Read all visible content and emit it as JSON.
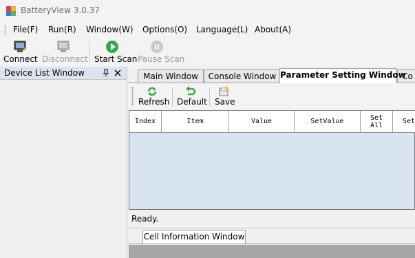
{
  "window": {
    "title": "BatteryView 3.0.37"
  },
  "menu": [
    "File(F)",
    "Run(R)",
    "Window(W)",
    "Options(O)",
    "Language(L)",
    "About(A)"
  ],
  "toolbar": {
    "connect": "Connect",
    "disconnect": "Disconnect",
    "start_scan": "Start Scan",
    "pause_scan": "Pause Scan"
  },
  "dock": {
    "device_list_title": "Device List Window"
  },
  "tabs": [
    "Main Window",
    "Console Window",
    "Parameter Setting Window",
    "Co"
  ],
  "active_tab": "Parameter Setting Window",
  "param_toolbar": {
    "refresh": "Refresh",
    "default": "Default",
    "save": "Save"
  },
  "grid": {
    "columns": [
      "Index",
      "Item",
      "Value",
      "SetValue",
      "Set\nAll",
      "Set"
    ]
  },
  "status": {
    "text": "Ready."
  },
  "bottom_dock": {
    "tab": "Cell Information Window"
  },
  "colors": {
    "grid_bg": "#d8e4f2",
    "start_icon": "#3aa84a",
    "refresh_icon": "#3aa84a"
  }
}
